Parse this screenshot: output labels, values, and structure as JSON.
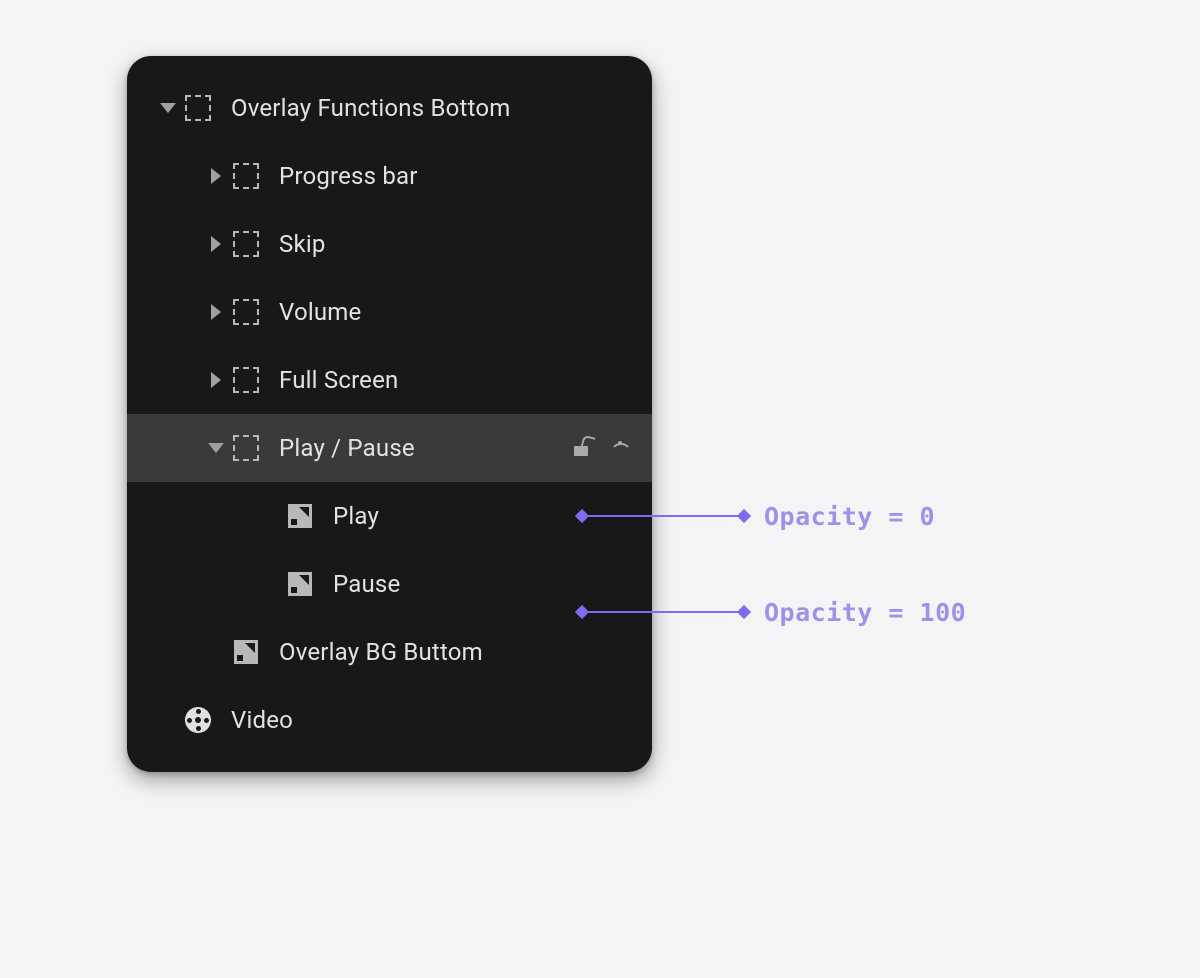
{
  "panel": {
    "root": {
      "label": "Overlay Functions Bottom",
      "expanded": true,
      "children": [
        {
          "label": "Progress bar",
          "expanded": false
        },
        {
          "label": "Skip",
          "expanded": false
        },
        {
          "label": "Volume",
          "expanded": false
        },
        {
          "label": "Full Screen",
          "expanded": false
        },
        {
          "label": "Play / Pause",
          "expanded": true,
          "selected": true,
          "children": [
            {
              "label": "Play",
              "type": "shape"
            },
            {
              "label": "Pause",
              "type": "shape"
            }
          ]
        },
        {
          "label": "Overlay BG Buttom",
          "type": "shape"
        }
      ]
    },
    "video_label": "Video"
  },
  "annotations": {
    "play": "Opacity = 0",
    "pause": "Opacity = 100"
  }
}
